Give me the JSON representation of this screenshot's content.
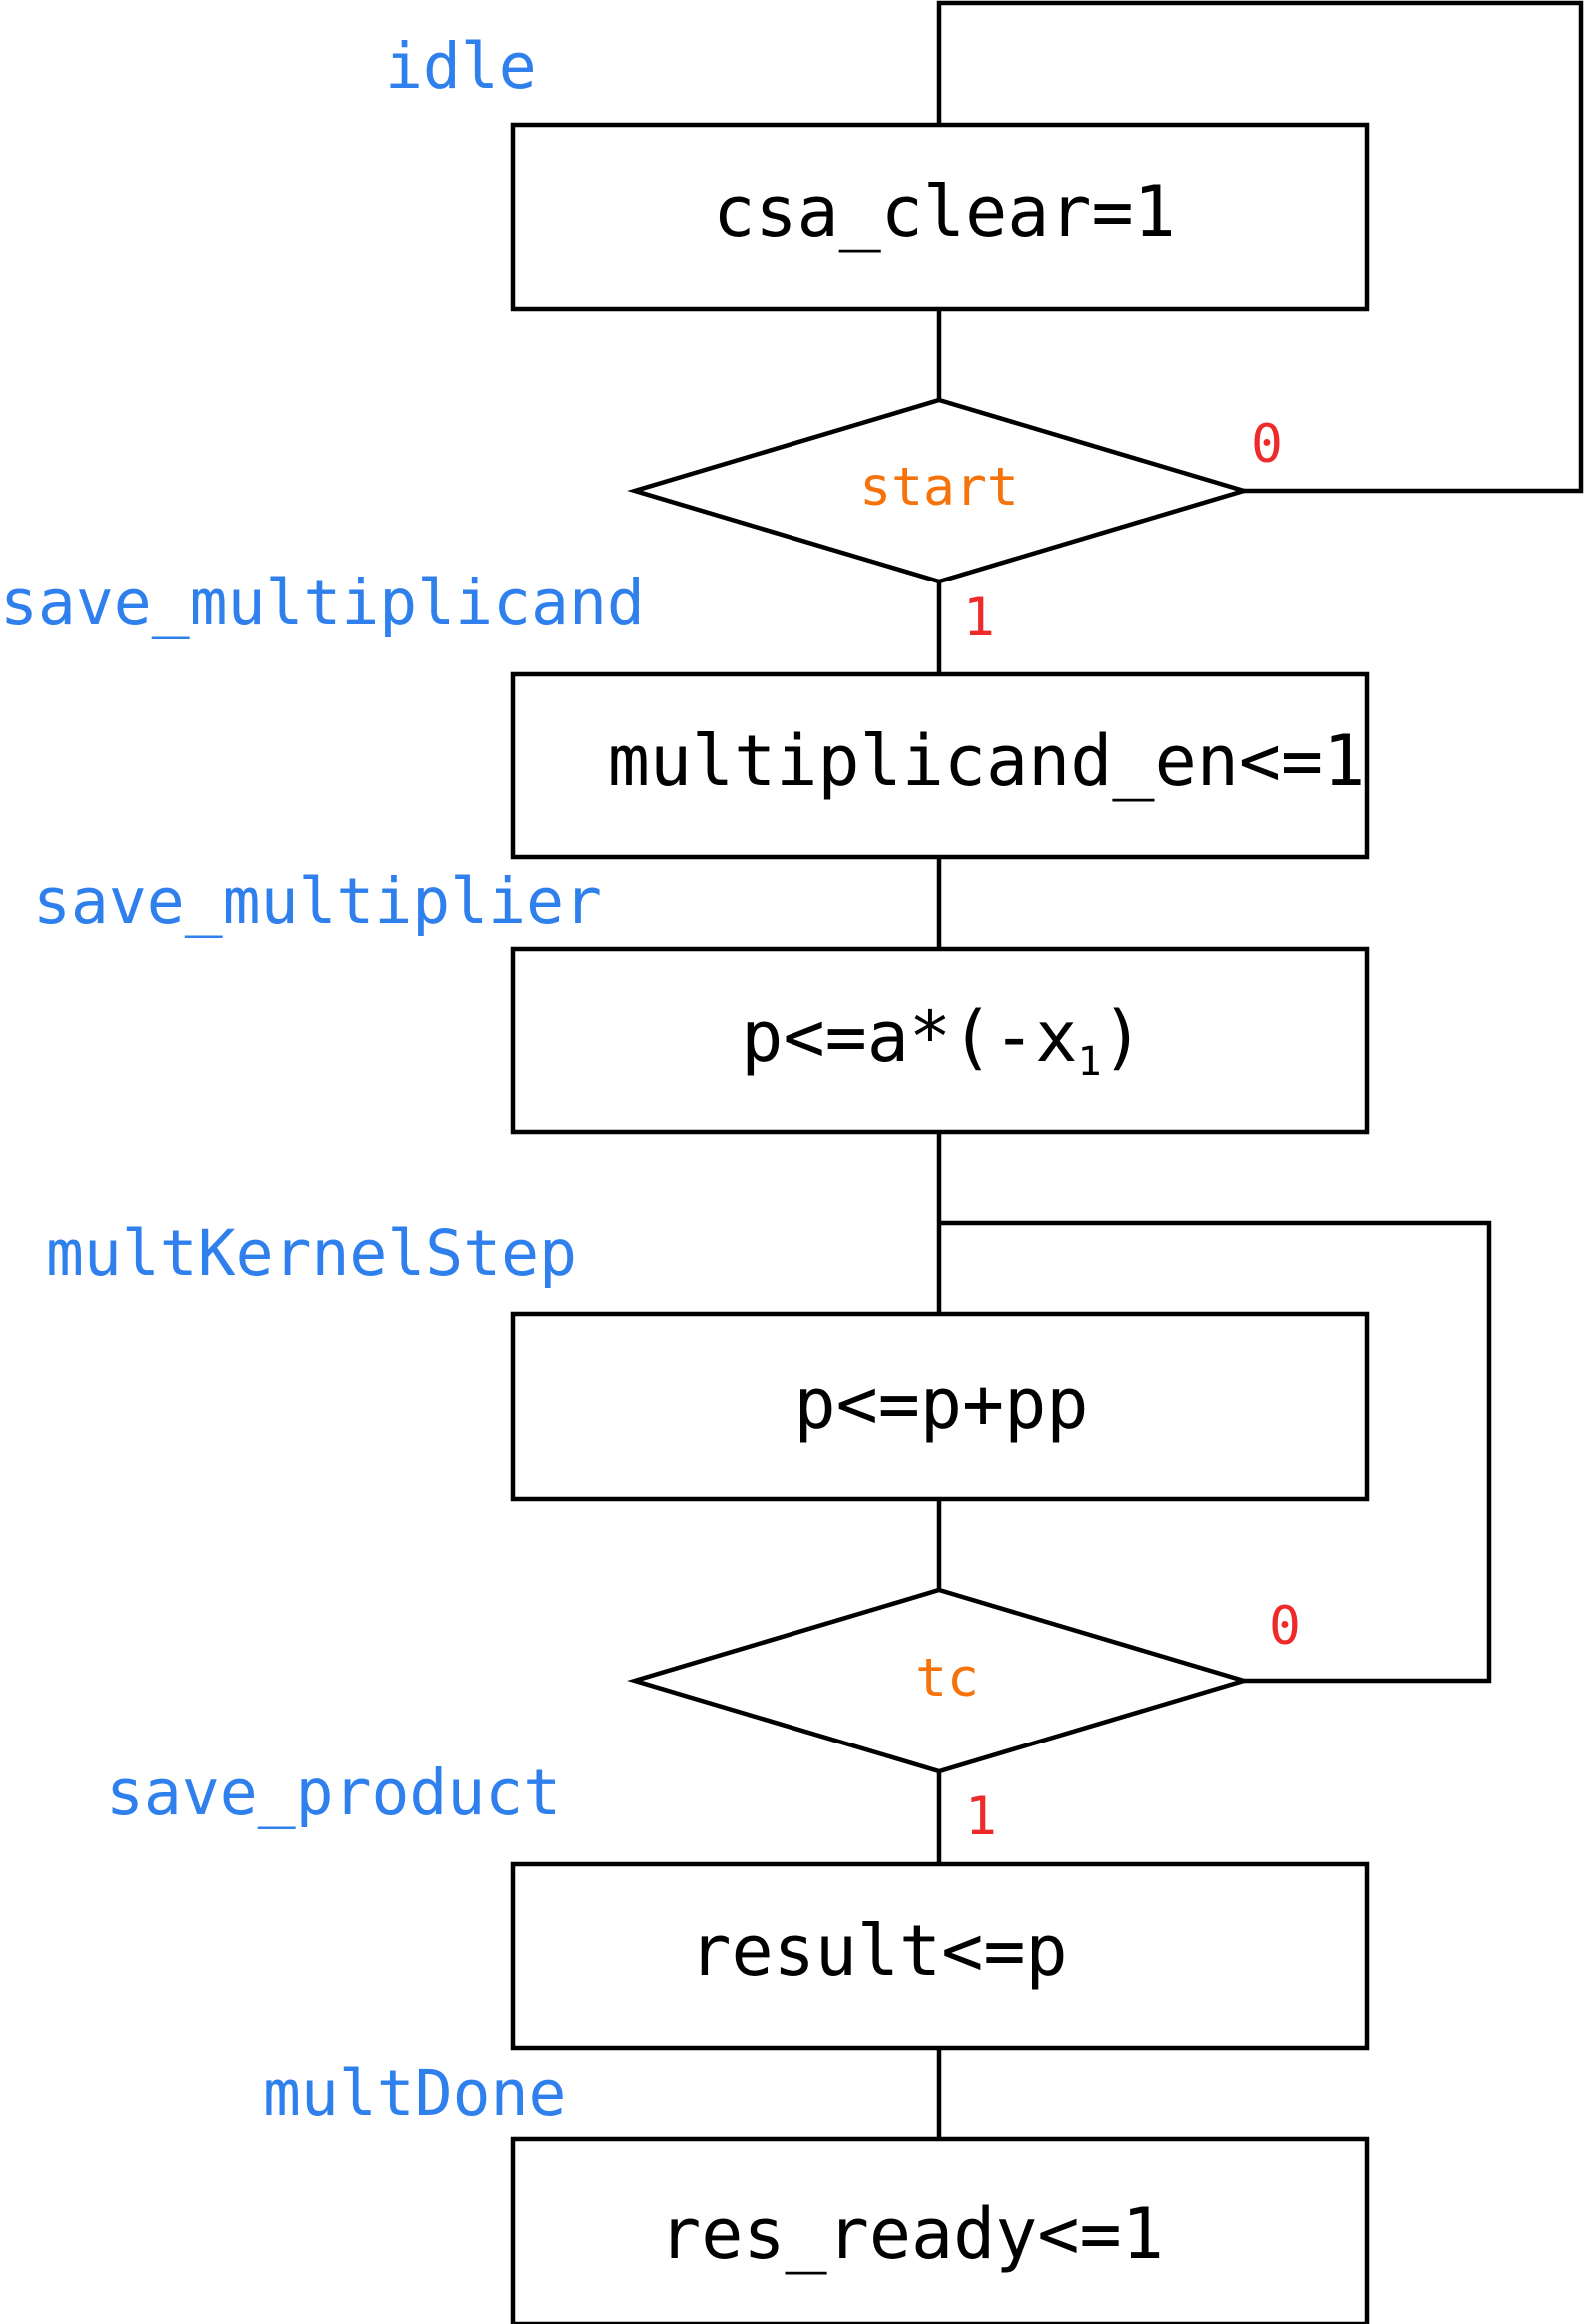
{
  "colors": {
    "state_label": "#2f80ed",
    "condition": "#f5730a",
    "branch": "#ee2a2a",
    "line": "#000000",
    "text": "#000000",
    "background": "#ffffff"
  },
  "states": {
    "idle": "idle",
    "save_multiplicand": "save_multiplicand",
    "save_multiplier": "save_multiplier",
    "mult_kernel_step": "multKernelStep",
    "save_product": "save_product",
    "mult_done": "multDone"
  },
  "actions": {
    "csa_clear": "csa_clear=1",
    "multiplicand_en": "multiplicand_en<=1",
    "p_init_main": "p<=a*(-x",
    "p_init_sub": "1",
    "p_init_close": ")",
    "p_accumulate": "p<=p+pp",
    "result": "result<=p",
    "res_ready": "res_ready<=1"
  },
  "decisions": {
    "start": {
      "condition": "start",
      "false_label": "0",
      "true_label": "1"
    },
    "tc": {
      "condition": "tc",
      "false_label": "0",
      "true_label": "1"
    }
  }
}
